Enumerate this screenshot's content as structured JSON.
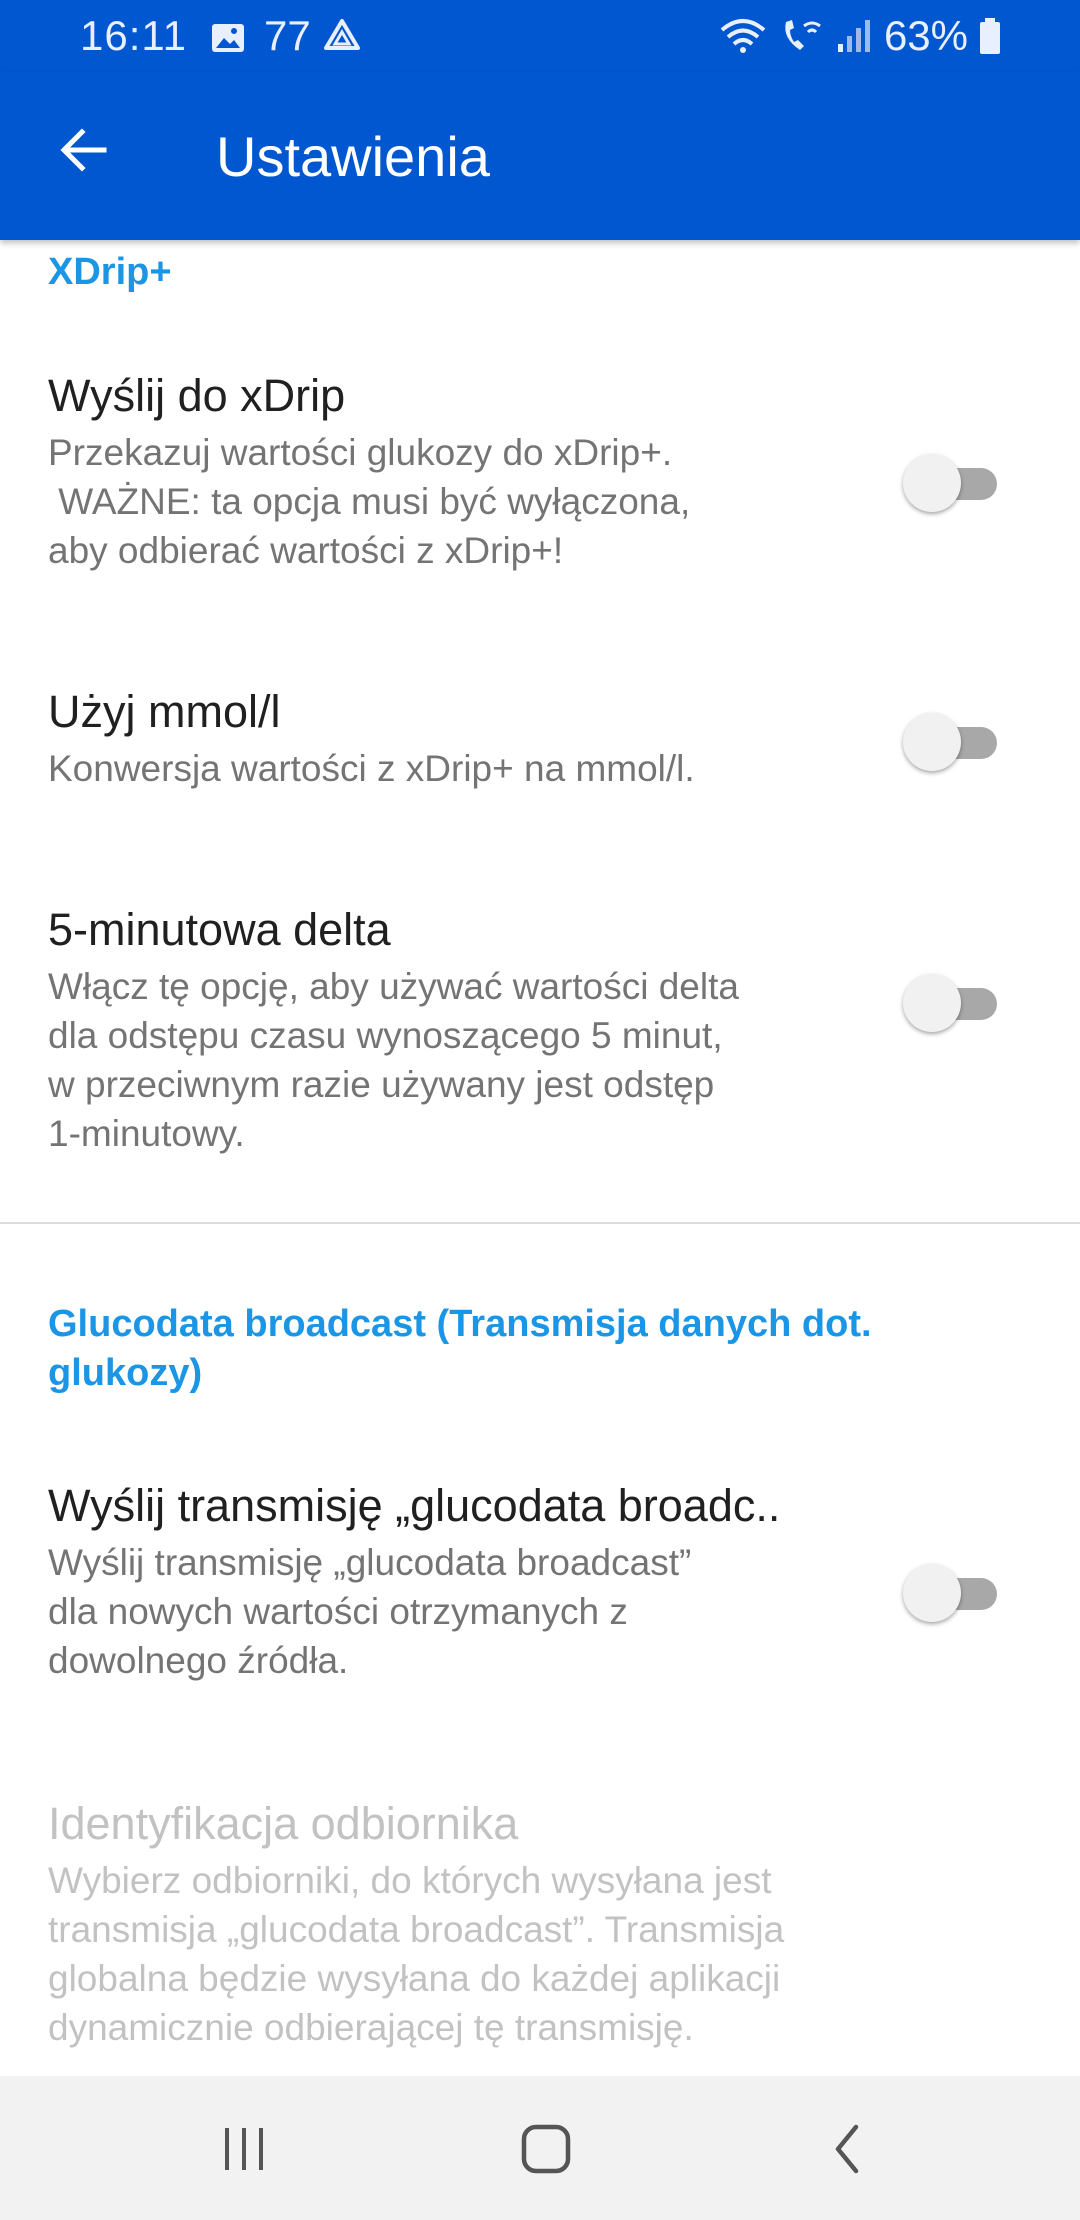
{
  "status_bar": {
    "time": "16:11",
    "notification_count": "77",
    "battery": "63%",
    "icons": [
      "gallery-icon",
      "drive-icon",
      "wifi-icon",
      "wifi-calling-icon",
      "signal-icon",
      "battery-icon"
    ]
  },
  "app_bar": {
    "title": "Ustawienia",
    "background_color": "#0057cf",
    "back_icon": "arrow-back-icon"
  },
  "sections": [
    {
      "header": "XDrip+",
      "items": [
        {
          "title": "Wyślij do xDrip",
          "summary_lines": [
            "Przekazuj wartości glukozy do xDrip+.",
            " WAŻNE: ta opcja musi być wyłączona,",
            "aby odbierać wartości z xDrip+!"
          ],
          "enabled": false
        },
        {
          "title": "Użyj mmol/l",
          "summary_lines": [
            "Konwersja wartości z xDrip+ na mmol/l."
          ],
          "enabled": false
        },
        {
          "title": "5-minutowa delta",
          "summary_lines": [
            "Włącz tę opcję, aby używać wartości delta",
            "dla odstępu czasu wynoszącego 5 minut,",
            "w przeciwnym razie używany jest odstęp",
            "1-minutowy."
          ],
          "enabled": false
        }
      ]
    },
    {
      "header_lines": [
        "Glucodata broadcast (Transmisja danych dot.",
        "glukozy)"
      ],
      "items": [
        {
          "title": "Wyślij transmisję „glucodata broadc..",
          "summary_lines": [
            "Wyślij transmisję „glucodata broadcast”",
            "dla nowych wartości otrzymanych z",
            "dowolnego źródła."
          ],
          "enabled": false
        },
        {
          "title": "Identyfikacja odbiornika",
          "summary_lines": [
            "Wybierz odbiorniki, do których wysyłana jest",
            "transmisja „glucodata broadcast”. Transmisja",
            "globalna będzie wysyłana do każdej aplikacji",
            "dynamicznie odbierającej tę transmisję."
          ],
          "disabled": true
        }
      ]
    }
  ],
  "nav_bar": {
    "buttons": [
      "recents-icon",
      "home-icon",
      "back-nav-icon"
    ]
  },
  "colors": {
    "accent": "#1b96e6",
    "primary": "#0057cf",
    "switch_track_off": "#a8a8a8"
  }
}
